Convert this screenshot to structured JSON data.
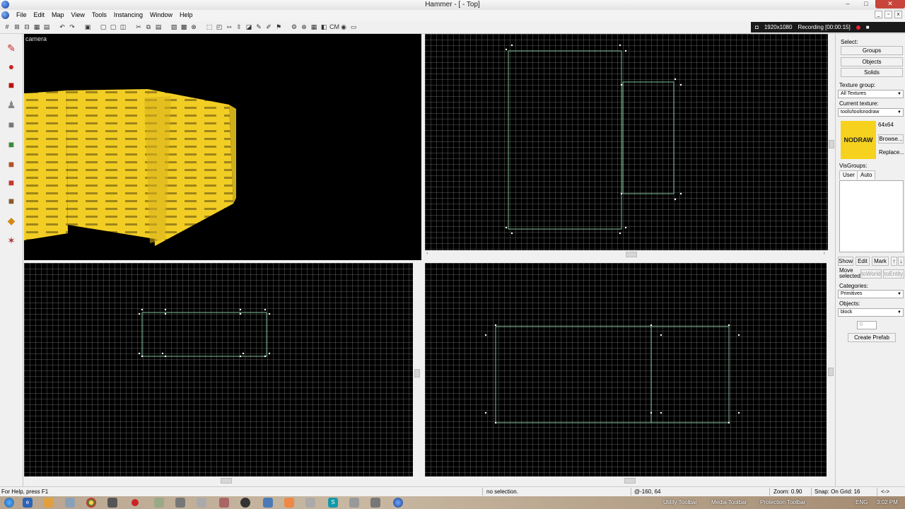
{
  "window": {
    "title": "Hammer - [ - Top]",
    "minimize": "–",
    "maximize": "□",
    "close": "✕"
  },
  "menu": {
    "items": [
      "File",
      "Edit",
      "Map",
      "View",
      "Tools",
      "Instancing",
      "Window",
      "Help"
    ]
  },
  "recording": {
    "resolution": "1920x1080",
    "status": "Recording [00:00:15]"
  },
  "viewports": {
    "camera_label": "camera",
    "texture_word": "NODRAW"
  },
  "right_panel": {
    "select_label": "Select:",
    "select_buttons": [
      "Groups",
      "Objects",
      "Solids"
    ],
    "texture_group_label": "Texture group:",
    "texture_group_value": "All Textures",
    "current_texture_label": "Current texture:",
    "current_texture_value": "tools/toolsnodraw",
    "texture_size": "64x64",
    "texture_preview": "NODRAW",
    "browse": "Browse...",
    "replace": "Replace...",
    "visgroups_label": "VisGroups:",
    "vis_tabs": [
      "User",
      "Auto"
    ],
    "vis_buttons": [
      "Show",
      "Edit",
      "Mark"
    ],
    "move_selected_label": "Move selected:",
    "to_world": "toWorld",
    "to_entity": "toEntity",
    "categories_label": "Categories:",
    "categories_value": "Primitives",
    "objects_label": "Objects:",
    "objects_value": "block",
    "spinner_value": "0",
    "create_prefab": "Create Prefab"
  },
  "status": {
    "help": "For Help, press F1",
    "selection": "no selection.",
    "coords": "@-160, 64",
    "zoom": "Zoom: 0.90",
    "snap": "Snap: On Grid: 16",
    "arrows": "<->"
  },
  "taskbar": {
    "toolbars": [
      "Utility Toolbar",
      "Media Toolbar",
      "Protection Toolbar"
    ],
    "lang": "ENG",
    "time": "3:02 PM"
  }
}
